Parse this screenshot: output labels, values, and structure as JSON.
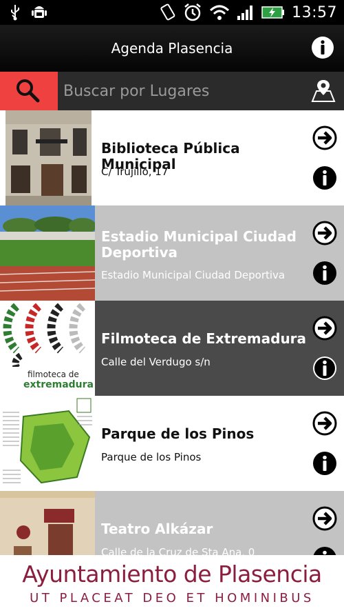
{
  "status_bar": {
    "time": "13:57",
    "icons": [
      "usb-icon",
      "android-debug-icon",
      "vibrate-icon",
      "alarm-icon",
      "wifi-icon",
      "signal-icon",
      "battery-charging-icon"
    ]
  },
  "header": {
    "title": "Agenda Plasencia",
    "info_icon": "info-icon"
  },
  "search": {
    "placeholder": "Buscar por Lugares",
    "value": "",
    "search_icon": "search-icon",
    "map_icon": "map-marker-icon"
  },
  "places": [
    {
      "title": "Biblioteca Pública Municipal",
      "address": "C/ Trujillo, 17",
      "style": "white"
    },
    {
      "title": "Estadio Municipal Ciudad Deportiva",
      "address": "Estadio Municipal Ciudad Deportiva",
      "style": "gray"
    },
    {
      "title": "Filmoteca de Extremadura",
      "address": "Calle del Verdugo s/n",
      "style": "dark",
      "thumb_text": [
        "filmoteca de",
        "extremadura"
      ]
    },
    {
      "title": "Parque de los Pinos",
      "address": "Parque de los Pinos",
      "style": "white"
    },
    {
      "title": "Teatro Alkázar",
      "address": "Calle de la Cruz de Sta Ana, 0",
      "style": "gray"
    }
  ],
  "footer": {
    "name": "Ayuntamiento de Plasencia",
    "motto": "UT PLACEAT DEO ET HOMINIBUS"
  },
  "colors": {
    "search_accent": "#f04141",
    "brand": "#8b1e3f",
    "row_gray": "#c3c3c3",
    "row_dark": "#4a4a4a"
  }
}
